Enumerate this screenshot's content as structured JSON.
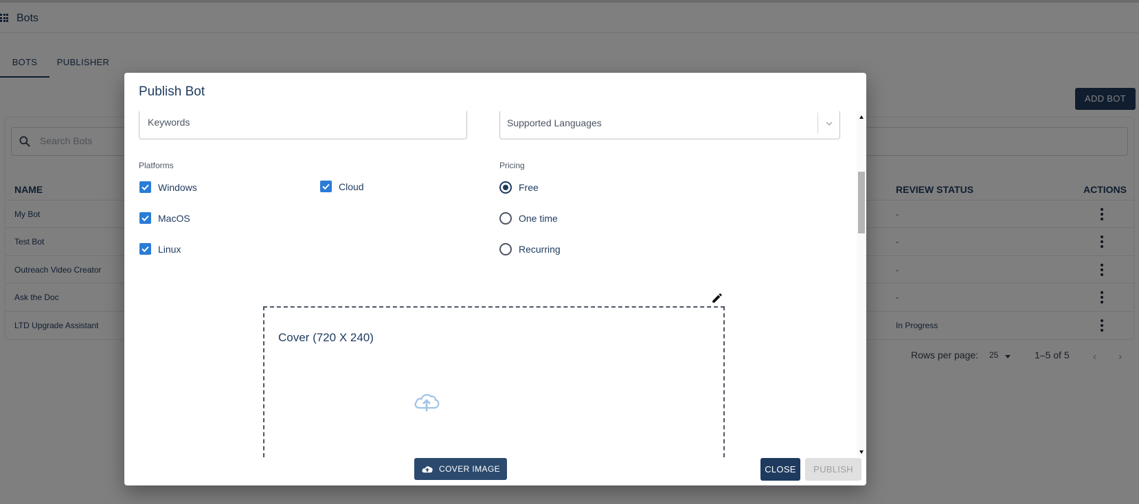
{
  "app": {
    "title": "Bots"
  },
  "tabs": [
    {
      "label": "BOTS",
      "active": true
    },
    {
      "label": "PUBLISHER",
      "active": false
    }
  ],
  "toolbar": {
    "add_bot_label": "ADD BOT"
  },
  "search": {
    "placeholder": "Search Bots"
  },
  "table": {
    "columns": {
      "name": "NAME",
      "review_status": "REVIEW STATUS",
      "actions": "ACTIONS"
    },
    "rows": [
      {
        "name": "My Bot",
        "review_status": "-"
      },
      {
        "name": "Test Bot",
        "review_status": "-"
      },
      {
        "name": "Outreach Video Creator",
        "review_status": "-"
      },
      {
        "name": "Ask the Doc",
        "review_status": "-"
      },
      {
        "name": "LTD Upgrade Assistant",
        "review_status": "In Progress"
      }
    ]
  },
  "pagination": {
    "rows_per_page_label": "Rows per page:",
    "rows_per_page": "25",
    "range": "1–5 of 5"
  },
  "dialog": {
    "title": "Publish Bot",
    "keywords_placeholder": "Keywords",
    "languages_placeholder": "Supported Languages",
    "platforms_label": "Platforms",
    "platforms": [
      {
        "label": "Windows",
        "checked": true
      },
      {
        "label": "Cloud",
        "checked": true
      },
      {
        "label": "MacOS",
        "checked": true
      },
      {
        "label": "Linux",
        "checked": true
      }
    ],
    "pricing_label": "Pricing",
    "pricing": [
      {
        "label": "Free",
        "selected": true
      },
      {
        "label": "One time",
        "selected": false
      },
      {
        "label": "Recurring",
        "selected": false
      }
    ],
    "cover_label": "Cover (720 X 240)",
    "cover_button": "COVER IMAGE",
    "close_label": "CLOSE",
    "publish_label": "PUBLISH"
  },
  "colors": {
    "primary": "#1e3a5f",
    "checkbox": "#2b7cd6",
    "disabled": "#e0e0e0"
  }
}
